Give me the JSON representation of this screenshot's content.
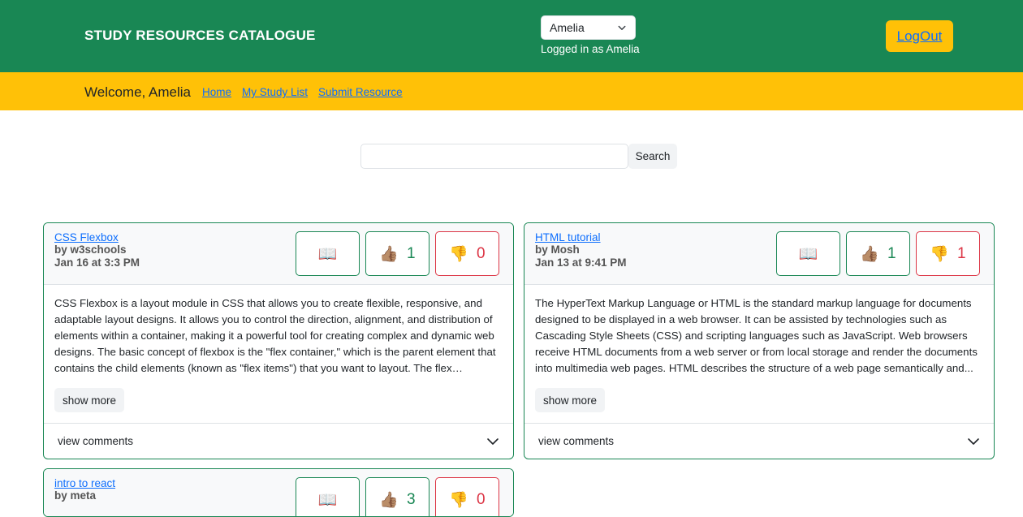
{
  "header": {
    "brand": "STUDY RESOURCES CATALOGUE",
    "selected_user": "Amelia",
    "logged_in_text": "Logged in as Amelia",
    "logout_label": "LogOut"
  },
  "nav": {
    "welcome": "Welcome, Amelia",
    "links": [
      "Home",
      "My Study List",
      "Submit Resource"
    ]
  },
  "search": {
    "value": "",
    "button_label": "Search"
  },
  "resources": [
    {
      "title": "CSS Flexbox",
      "author": "by w3schools",
      "date": "Jan 16 at 3:3 PM",
      "likes": "1",
      "dislikes": "0",
      "description": "CSS Flexbox is a layout module in CSS that allows you to create flexible, responsive, and adaptable layout designs. It allows you to control the direction, alignment, and distribution of elements within a container, making it a powerful tool for creating complex and dynamic web designs. The basic concept of flexbox is the \"flex container,\" which is the parent element that contains the child elements (known as \"flex items\") that you want to layout. The flex container...",
      "show_more_label": "show more",
      "comments_label": "view comments"
    },
    {
      "title": "HTML tutorial",
      "author": "by Mosh",
      "date": "Jan 13 at 9:41 PM",
      "likes": "1",
      "dislikes": "1",
      "description": "The HyperText Markup Language or HTML is the standard markup language for documents designed to be displayed in a web browser. It can be assisted by technologies such as Cascading Style Sheets (CSS) and scripting languages such as JavaScript. Web browsers receive HTML documents from a web server or from local storage and render the documents into multimedia web pages. HTML describes the structure of a web page semantically and...",
      "show_more_label": "show more",
      "comments_label": "view comments"
    },
    {
      "title": "intro to react",
      "author": "by meta",
      "likes": "3",
      "dislikes": "0"
    }
  ],
  "icons": {
    "book": "📖",
    "thumbs_up": "👍🏽",
    "thumbs_down": "👎"
  },
  "colors": {
    "primary_green": "#198754",
    "accent_yellow": "#ffc107",
    "link_blue": "#0d6efd",
    "danger_red": "#dc3545"
  }
}
